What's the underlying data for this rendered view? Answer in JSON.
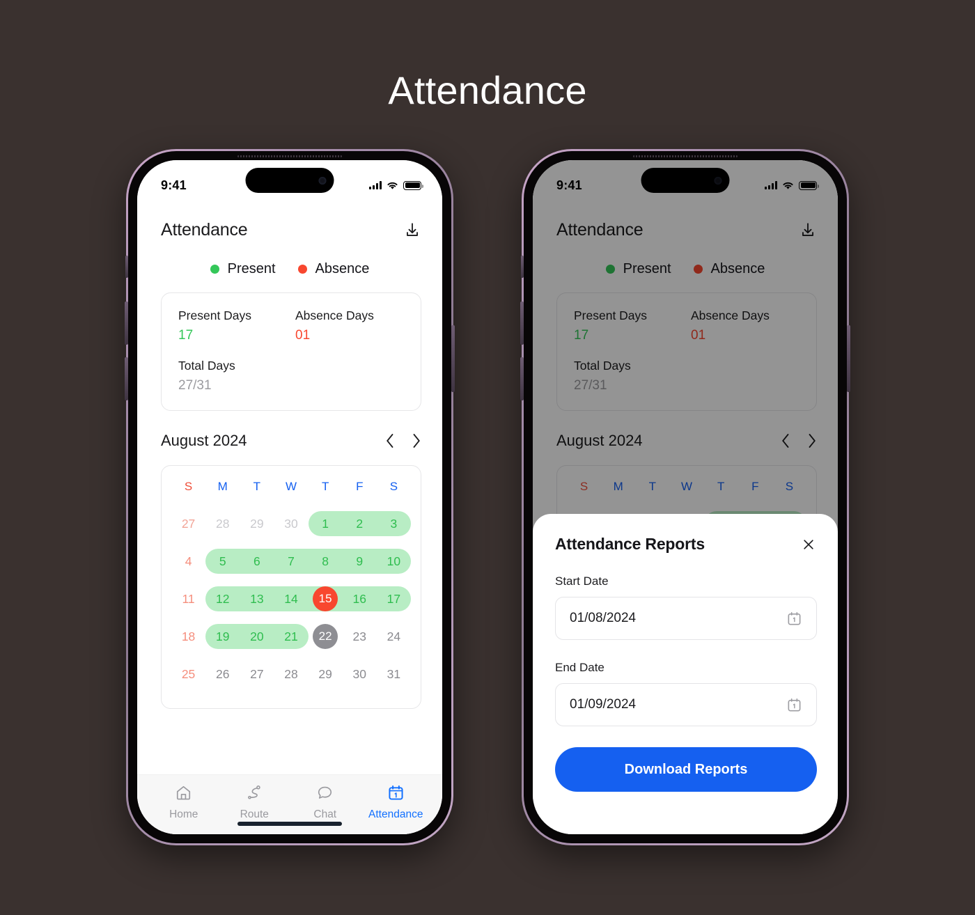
{
  "page": {
    "title": "Attendance",
    "background_color": "#3a312f"
  },
  "status_bar": {
    "time": "9:41",
    "signal_icon": "signal-bars-icon",
    "wifi_icon": "wifi-icon",
    "battery_icon": "battery-icon"
  },
  "screen": {
    "header": {
      "title": "Attendance",
      "download_icon": "download-icon"
    },
    "legend": [
      {
        "label": "Present",
        "color": "#34c759",
        "dot": "green-dot-icon"
      },
      {
        "label": "Absence",
        "color": "#f8472f",
        "dot": "red-dot-icon"
      }
    ],
    "stats": {
      "present_label": "Present Days",
      "present_value": "17",
      "absence_label": "Absence Days",
      "absence_value": "01",
      "total_label": "Total Days",
      "total_value": "27/31"
    },
    "month": {
      "label": "August 2024",
      "prev_icon": "chevron-left-icon",
      "next_icon": "chevron-right-icon"
    },
    "calendar": {
      "day_headers": [
        "S",
        "M",
        "T",
        "W",
        "T",
        "F",
        "S"
      ],
      "weeks": [
        [
          {
            "d": "27",
            "state": "sun-dim"
          },
          {
            "d": "28",
            "state": "dim"
          },
          {
            "d": "29",
            "state": "dim"
          },
          {
            "d": "30",
            "state": "dim"
          },
          {
            "d": "1",
            "state": "present"
          },
          {
            "d": "2",
            "state": "present"
          },
          {
            "d": "3",
            "state": "present"
          }
        ],
        [
          {
            "d": "4",
            "state": "sun"
          },
          {
            "d": "5",
            "state": "present"
          },
          {
            "d": "6",
            "state": "present"
          },
          {
            "d": "7",
            "state": "present"
          },
          {
            "d": "8",
            "state": "present"
          },
          {
            "d": "9",
            "state": "present"
          },
          {
            "d": "10",
            "state": "present"
          }
        ],
        [
          {
            "d": "11",
            "state": "sun"
          },
          {
            "d": "12",
            "state": "present"
          },
          {
            "d": "13",
            "state": "present"
          },
          {
            "d": "14",
            "state": "present"
          },
          {
            "d": "15",
            "state": "absent"
          },
          {
            "d": "16",
            "state": "present"
          },
          {
            "d": "17",
            "state": "present"
          }
        ],
        [
          {
            "d": "18",
            "state": "sun"
          },
          {
            "d": "19",
            "state": "present"
          },
          {
            "d": "20",
            "state": "present"
          },
          {
            "d": "21",
            "state": "present"
          },
          {
            "d": "22",
            "state": "today"
          },
          {
            "d": "23",
            "state": "plain"
          },
          {
            "d": "24",
            "state": "plain"
          }
        ],
        [
          {
            "d": "25",
            "state": "sun"
          },
          {
            "d": "26",
            "state": "plain"
          },
          {
            "d": "27",
            "state": "plain"
          },
          {
            "d": "28",
            "state": "plain"
          },
          {
            "d": "29",
            "state": "plain"
          },
          {
            "d": "30",
            "state": "plain"
          },
          {
            "d": "31",
            "state": "plain"
          }
        ]
      ],
      "bands": [
        {
          "week": 0,
          "start": 4,
          "end": 6
        },
        {
          "week": 1,
          "start": 1,
          "end": 6
        },
        {
          "week": 2,
          "start": 1,
          "end": 6
        },
        {
          "week": 3,
          "start": 1,
          "end": 3
        }
      ],
      "band_color": "#b8edc4"
    },
    "tab_bar": [
      {
        "label": "Home",
        "icon": "home-icon",
        "active": false
      },
      {
        "label": "Route",
        "icon": "route-icon",
        "active": false
      },
      {
        "label": "Chat",
        "icon": "chat-icon",
        "active": false
      },
      {
        "label": "Attendance",
        "icon": "calendar-icon",
        "active": true
      }
    ]
  },
  "modal": {
    "title": "Attendance Reports",
    "close_icon": "close-icon",
    "start_label": "Start Date",
    "start_value": "01/08/2024",
    "end_label": "End Date",
    "end_value": "01/09/2024",
    "calendar_icon": "calendar-picker-icon",
    "submit_label": "Download Reports",
    "submit_color": "#1560f0"
  }
}
